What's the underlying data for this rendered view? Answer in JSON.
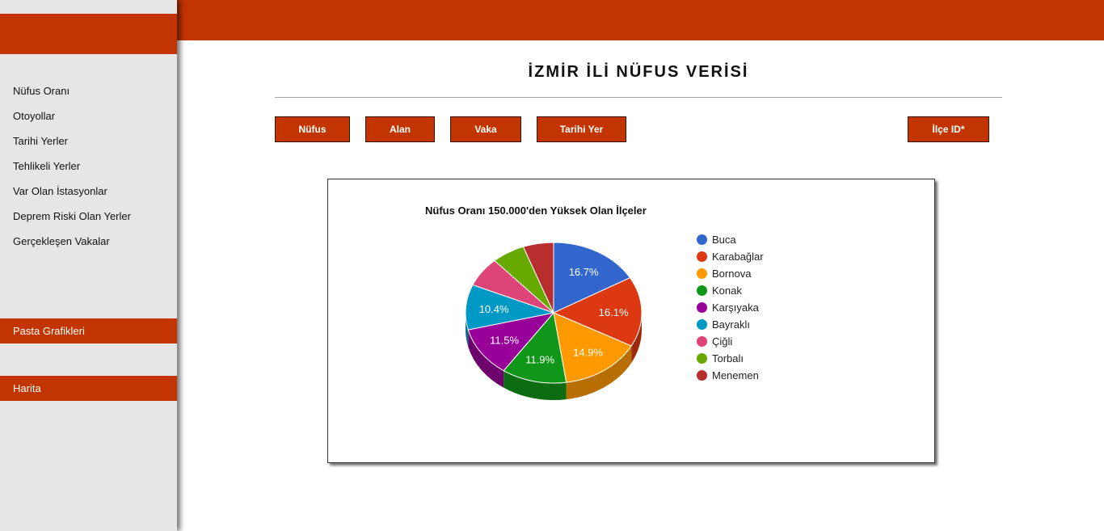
{
  "sidebar": {
    "menu": [
      "Nüfus Oranı",
      "Otoyollar",
      "Tarihi Yerler",
      "Tehlikeli Yerler",
      "Var Olan İstasyonlar",
      "Deprem Riski Olan Yerler",
      "Gerçekleşen Vakalar"
    ],
    "pie_charts_label": "Pasta Grafikleri",
    "map_label": "Harita"
  },
  "header": {
    "title": "İZMİR İLİ NÜFUS VERİSİ"
  },
  "toolbar": {
    "population": "Nüfus",
    "area": "Alan",
    "cases": "Vaka",
    "historic": "Tarihi Yer",
    "district_id": "İlçe ID*"
  },
  "colors": {
    "accent": "#c23400",
    "sidebar_bg": "#e6e6e6"
  },
  "chart_data": {
    "type": "pie",
    "title": "Nüfus Oranı 150.000'den Yüksek Olan İlçeler",
    "legend_position": "right",
    "slices": [
      {
        "label": "Buca",
        "value": 16.7,
        "color": "#3366cc",
        "data_label": "16.7%"
      },
      {
        "label": "Karabağlar",
        "value": 16.1,
        "color": "#dc3912",
        "data_label": "16.1%"
      },
      {
        "label": "Bornova",
        "value": 14.9,
        "color": "#ff9900",
        "data_label": "14.9%"
      },
      {
        "label": "Konak",
        "value": 11.9,
        "color": "#109618",
        "data_label": "11.9%"
      },
      {
        "label": "Karşıyaka",
        "value": 11.5,
        "color": "#990099",
        "data_label": "11.5%"
      },
      {
        "label": "Bayraklı",
        "value": 10.4,
        "color": "#0099c6",
        "data_label": "10.4%"
      },
      {
        "label": "Çiğli",
        "value": 6.8,
        "color": "#dd4477",
        "data_label": ""
      },
      {
        "label": "Torbalı",
        "value": 6.1,
        "color": "#66aa00",
        "data_label": ""
      },
      {
        "label": "Menemen",
        "value": 5.6,
        "color": "#b82e2e",
        "data_label": ""
      }
    ]
  }
}
